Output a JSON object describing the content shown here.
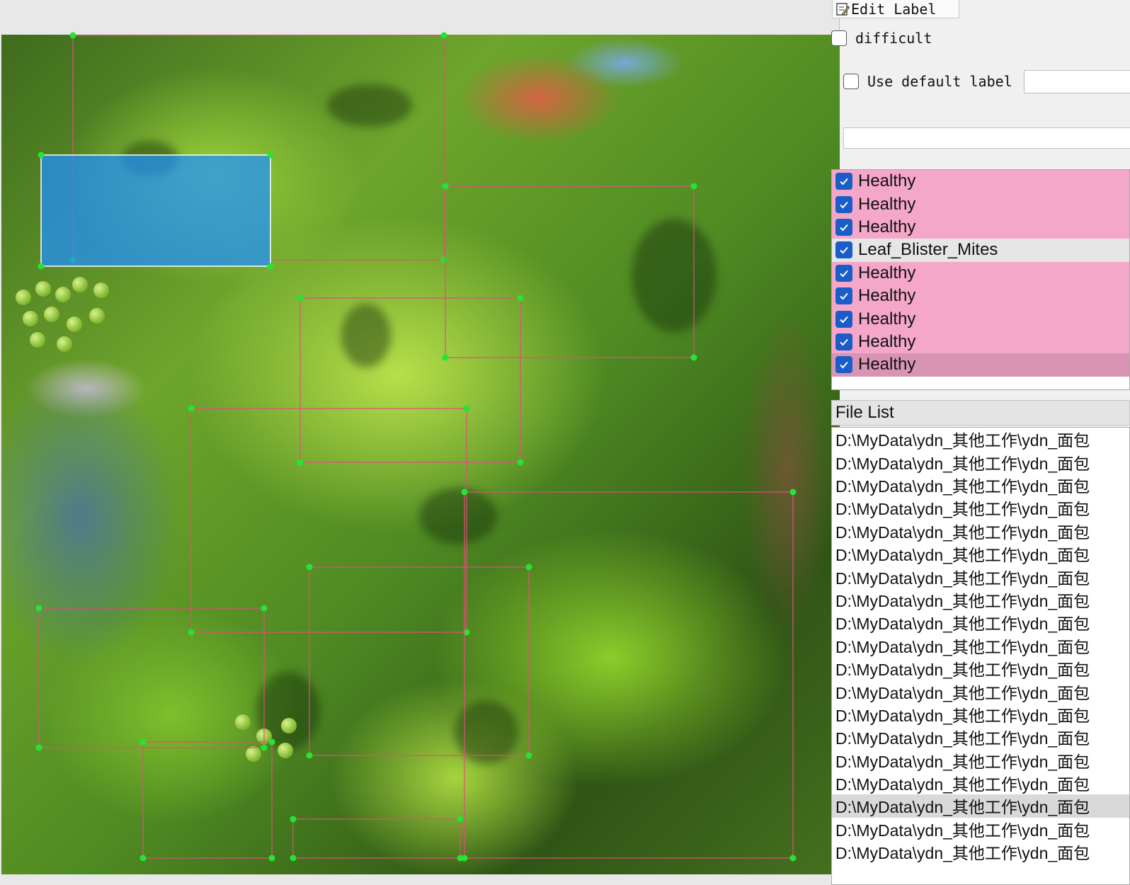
{
  "toolbar": {
    "edit_label": "Edit Label"
  },
  "options": {
    "difficult_label": "difficult",
    "difficult_checked": false,
    "use_default_label": "Use default label",
    "use_default_checked": false,
    "default_label_value": ""
  },
  "label_list": {
    "items": [
      {
        "label": "Healthy",
        "checked": true,
        "color": "#f4a7c8"
      },
      {
        "label": "Healthy",
        "checked": true,
        "color": "#f4a7c8"
      },
      {
        "label": "Healthy",
        "checked": true,
        "color": "#f4a7c8"
      },
      {
        "label": "Leaf_Blister_Mites",
        "checked": true,
        "color": "#e6e6e6"
      },
      {
        "label": "Healthy",
        "checked": true,
        "color": "#f4a7c8"
      },
      {
        "label": "Healthy",
        "checked": true,
        "color": "#f4a7c8"
      },
      {
        "label": "Healthy",
        "checked": true,
        "color": "#f4a7c8"
      },
      {
        "label": "Healthy",
        "checked": true,
        "color": "#f4a7c8"
      },
      {
        "label": "Healthy",
        "checked": true,
        "color": "#d895b3"
      }
    ]
  },
  "file_list": {
    "title": "File List",
    "items": [
      "D:\\MyData\\ydn_其他工作\\ydn_面包",
      "D:\\MyData\\ydn_其他工作\\ydn_面包",
      "D:\\MyData\\ydn_其他工作\\ydn_面包",
      "D:\\MyData\\ydn_其他工作\\ydn_面包",
      "D:\\MyData\\ydn_其他工作\\ydn_面包",
      "D:\\MyData\\ydn_其他工作\\ydn_面包",
      "D:\\MyData\\ydn_其他工作\\ydn_面包",
      "D:\\MyData\\ydn_其他工作\\ydn_面包",
      "D:\\MyData\\ydn_其他工作\\ydn_面包",
      "D:\\MyData\\ydn_其他工作\\ydn_面包",
      "D:\\MyData\\ydn_其他工作\\ydn_面包",
      "D:\\MyData\\ydn_其他工作\\ydn_面包",
      "D:\\MyData\\ydn_其他工作\\ydn_面包",
      "D:\\MyData\\ydn_其他工作\\ydn_面包",
      "D:\\MyData\\ydn_其他工作\\ydn_面包",
      "D:\\MyData\\ydn_其他工作\\ydn_面包",
      "D:\\MyData\\ydn_其他工作\\ydn_面包",
      "D:\\MyData\\ydn_其他工作\\ydn_面包",
      "D:\\MyData\\ydn_其他工作\\ydn_面包"
    ],
    "selected_index": 16
  },
  "colors": {
    "box_stroke": "#e0507a",
    "vertex": "#22e633",
    "selected_fill": "#1e90ff",
    "checkbox_checked": "#1a5dc8"
  }
}
